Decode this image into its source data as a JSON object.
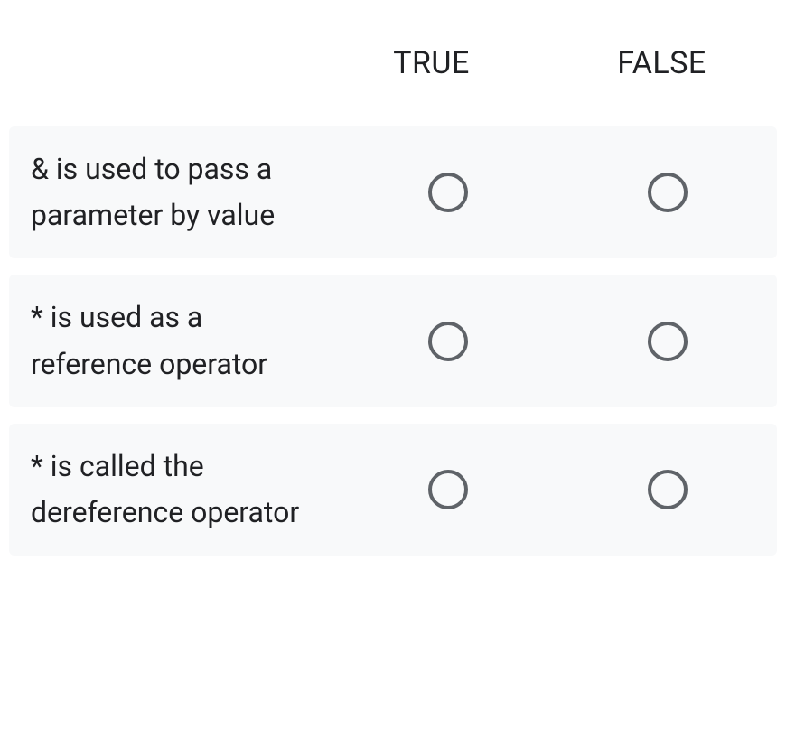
{
  "headers": {
    "col1": "TRUE",
    "col2": "FALSE"
  },
  "rows": [
    {
      "text": "& is used to pass a parameter by value"
    },
    {
      "text": "* is used as a reference operator"
    },
    {
      "text": "* is called the dereference operator"
    }
  ]
}
